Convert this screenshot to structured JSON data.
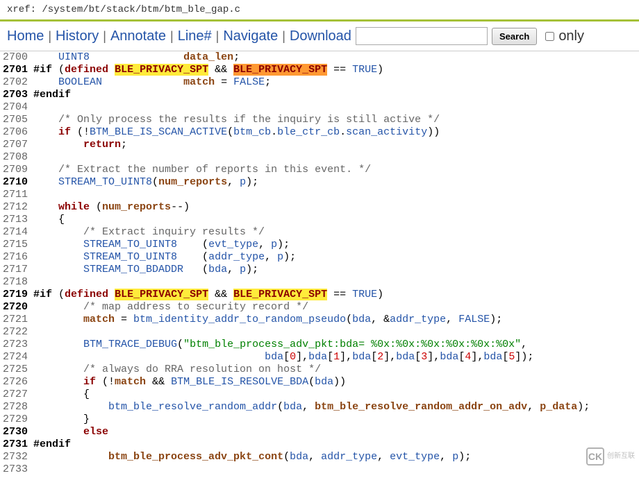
{
  "xref": "xref: /system/bt/stack/btm/btm_ble_gap.c",
  "toolbar": {
    "home": "Home",
    "history": "History",
    "annotate": "Annotate",
    "line": "Line#",
    "navigate": "Navigate",
    "download": "Download",
    "search_placeholder": "",
    "search_btn": "Search",
    "only": "only"
  },
  "code": {
    "2700": {
      "ln": "2700",
      "bold": false,
      "t": [
        "    ",
        {
          "c": "id",
          "s": "UINT8"
        },
        "               ",
        {
          "c": "var",
          "s": "data_len"
        },
        ";"
      ]
    },
    "2701": {
      "ln": "2701",
      "bold": true,
      "t": [
        {
          "c": "pp",
          "s": "#if"
        },
        " (",
        {
          "c": "kw",
          "s": "defined"
        },
        " ",
        {
          "c": "hl-y",
          "s": "BLE_PRIVACY_SPT"
        },
        " && ",
        {
          "c": "hl-o",
          "s": "BLE_PRIVACY_SPT"
        },
        " == ",
        {
          "c": "id",
          "s": "TRUE"
        },
        ")"
      ]
    },
    "2702": {
      "ln": "2702",
      "bold": false,
      "t": [
        "    ",
        {
          "c": "id",
          "s": "BOOLEAN"
        },
        "             ",
        {
          "c": "var",
          "s": "match"
        },
        " = ",
        {
          "c": "id",
          "s": "FALSE"
        },
        ";"
      ]
    },
    "2703": {
      "ln": "2703",
      "bold": true,
      "t": [
        {
          "c": "pp",
          "s": "#endif"
        }
      ]
    },
    "2704": {
      "ln": "2704",
      "bold": false,
      "t": [
        ""
      ]
    },
    "2705": {
      "ln": "2705",
      "bold": false,
      "t": [
        "    ",
        {
          "c": "cmt",
          "s": "/* Only process the results if the inquiry is still active */"
        }
      ]
    },
    "2706": {
      "ln": "2706",
      "bold": false,
      "t": [
        "    ",
        {
          "c": "kw",
          "s": "if"
        },
        " (!",
        {
          "c": "id",
          "s": "BTM_BLE_IS_SCAN_ACTIVE"
        },
        "(",
        {
          "c": "id",
          "s": "btm_cb"
        },
        ".",
        {
          "c": "id",
          "s": "ble_ctr_cb"
        },
        ".",
        {
          "c": "id",
          "s": "scan_activity"
        },
        "))"
      ]
    },
    "2707": {
      "ln": "2707",
      "bold": false,
      "t": [
        "        ",
        {
          "c": "kw",
          "s": "return"
        },
        ";"
      ]
    },
    "2708": {
      "ln": "2708",
      "bold": false,
      "t": [
        ""
      ]
    },
    "2709": {
      "ln": "2709",
      "bold": false,
      "t": [
        "    ",
        {
          "c": "cmt",
          "s": "/* Extract the number of reports in this event. */"
        }
      ]
    },
    "2710": {
      "ln": "2710",
      "bold": true,
      "t": [
        "    ",
        {
          "c": "id",
          "s": "STREAM_TO_UINT8"
        },
        "(",
        {
          "c": "var",
          "s": "num_reports"
        },
        ", ",
        {
          "c": "id",
          "s": "p"
        },
        ");"
      ]
    },
    "2711": {
      "ln": "2711",
      "bold": false,
      "t": [
        ""
      ]
    },
    "2712": {
      "ln": "2712",
      "bold": false,
      "t": [
        "    ",
        {
          "c": "kw",
          "s": "while"
        },
        " (",
        {
          "c": "var",
          "s": "num_reports"
        },
        "--)"
      ]
    },
    "2713": {
      "ln": "2713",
      "bold": false,
      "t": [
        "    {"
      ]
    },
    "2714": {
      "ln": "2714",
      "bold": false,
      "t": [
        "        ",
        {
          "c": "cmt",
          "s": "/* Extract inquiry results */"
        }
      ]
    },
    "2715": {
      "ln": "2715",
      "bold": false,
      "t": [
        "        ",
        {
          "c": "id",
          "s": "STREAM_TO_UINT8"
        },
        "    (",
        {
          "c": "id",
          "s": "evt_type"
        },
        ", ",
        {
          "c": "id",
          "s": "p"
        },
        ");"
      ]
    },
    "2716": {
      "ln": "2716",
      "bold": false,
      "t": [
        "        ",
        {
          "c": "id",
          "s": "STREAM_TO_UINT8"
        },
        "    (",
        {
          "c": "id",
          "s": "addr_type"
        },
        ", ",
        {
          "c": "id",
          "s": "p"
        },
        ");"
      ]
    },
    "2717": {
      "ln": "2717",
      "bold": false,
      "t": [
        "        ",
        {
          "c": "id",
          "s": "STREAM_TO_BDADDR"
        },
        "   (",
        {
          "c": "id",
          "s": "bda"
        },
        ", ",
        {
          "c": "id",
          "s": "p"
        },
        ");"
      ]
    },
    "2718": {
      "ln": "2718",
      "bold": false,
      "t": [
        ""
      ]
    },
    "2719": {
      "ln": "2719",
      "bold": true,
      "t": [
        {
          "c": "pp",
          "s": "#if"
        },
        " (",
        {
          "c": "kw",
          "s": "defined"
        },
        " ",
        {
          "c": "hl-y",
          "s": "BLE_PRIVACY_SPT"
        },
        " && ",
        {
          "c": "hl-y",
          "s": "BLE_PRIVACY_SPT"
        },
        " == ",
        {
          "c": "id",
          "s": "TRUE"
        },
        ")"
      ]
    },
    "2720": {
      "ln": "2720",
      "bold": true,
      "t": [
        "        ",
        {
          "c": "cmt",
          "s": "/* map address to security record */"
        }
      ]
    },
    "2721": {
      "ln": "2721",
      "bold": false,
      "t": [
        "        ",
        {
          "c": "var",
          "s": "match"
        },
        " = ",
        {
          "c": "id",
          "s": "btm_identity_addr_to_random_pseudo"
        },
        "(",
        {
          "c": "id",
          "s": "bda"
        },
        ", &",
        {
          "c": "id",
          "s": "addr_type"
        },
        ", ",
        {
          "c": "id",
          "s": "FALSE"
        },
        ");"
      ]
    },
    "2722": {
      "ln": "2722",
      "bold": false,
      "t": [
        ""
      ]
    },
    "2723": {
      "ln": "2723",
      "bold": false,
      "t": [
        "        ",
        {
          "c": "id",
          "s": "BTM_TRACE_DEBUG"
        },
        "(",
        {
          "c": "str",
          "s": "\"btm_ble_process_adv_pkt:bda= %0x:%0x:%0x:%0x:%0x:%0x\""
        },
        ","
      ]
    },
    "2724": {
      "ln": "2724",
      "bold": false,
      "t": [
        "                                     ",
        {
          "c": "id",
          "s": "bda"
        },
        "[",
        {
          "c": "num",
          "s": "0"
        },
        "],",
        {
          "c": "id",
          "s": "bda"
        },
        "[",
        {
          "c": "num",
          "s": "1"
        },
        "],",
        {
          "c": "id",
          "s": "bda"
        },
        "[",
        {
          "c": "num",
          "s": "2"
        },
        "],",
        {
          "c": "id",
          "s": "bda"
        },
        "[",
        {
          "c": "num",
          "s": "3"
        },
        "],",
        {
          "c": "id",
          "s": "bda"
        },
        "[",
        {
          "c": "num",
          "s": "4"
        },
        "],",
        {
          "c": "id",
          "s": "bda"
        },
        "[",
        {
          "c": "num",
          "s": "5"
        },
        "]);"
      ]
    },
    "2725": {
      "ln": "2725",
      "bold": false,
      "t": [
        "        ",
        {
          "c": "cmt",
          "s": "/* always do RRA resolution on host */"
        }
      ]
    },
    "2726": {
      "ln": "2726",
      "bold": false,
      "t": [
        "        ",
        {
          "c": "kw",
          "s": "if"
        },
        " (!",
        {
          "c": "var",
          "s": "match"
        },
        " && ",
        {
          "c": "id",
          "s": "BTM_BLE_IS_RESOLVE_BDA"
        },
        "(",
        {
          "c": "id",
          "s": "bda"
        },
        "))"
      ]
    },
    "2727": {
      "ln": "2727",
      "bold": false,
      "t": [
        "        {"
      ]
    },
    "2728": {
      "ln": "2728",
      "bold": false,
      "t": [
        "            ",
        {
          "c": "id",
          "s": "btm_ble_resolve_random_addr"
        },
        "(",
        {
          "c": "id",
          "s": "bda"
        },
        ", ",
        {
          "c": "var",
          "s": "btm_ble_resolve_random_addr_on_adv"
        },
        ", ",
        {
          "c": "var",
          "s": "p_data"
        },
        ");"
      ]
    },
    "2729": {
      "ln": "2729",
      "bold": false,
      "t": [
        "        }"
      ]
    },
    "2730": {
      "ln": "2730",
      "bold": true,
      "t": [
        "        ",
        {
          "c": "kw",
          "s": "else"
        }
      ]
    },
    "2731": {
      "ln": "2731",
      "bold": true,
      "t": [
        {
          "c": "pp",
          "s": "#endif"
        }
      ]
    },
    "2732": {
      "ln": "2732",
      "bold": false,
      "t": [
        "            ",
        {
          "c": "var",
          "s": "btm_ble_process_adv_pkt_cont"
        },
        "(",
        {
          "c": "id",
          "s": "bda"
        },
        ", ",
        {
          "c": "id",
          "s": "addr_type"
        },
        ", ",
        {
          "c": "id",
          "s": "evt_type"
        },
        ", ",
        {
          "c": "id",
          "s": "p"
        },
        ");"
      ]
    },
    "2733": {
      "ln": "2733",
      "bold": false,
      "t": [
        ""
      ]
    }
  },
  "watermark": {
    "icon": "CK",
    "text": "创新互联"
  }
}
